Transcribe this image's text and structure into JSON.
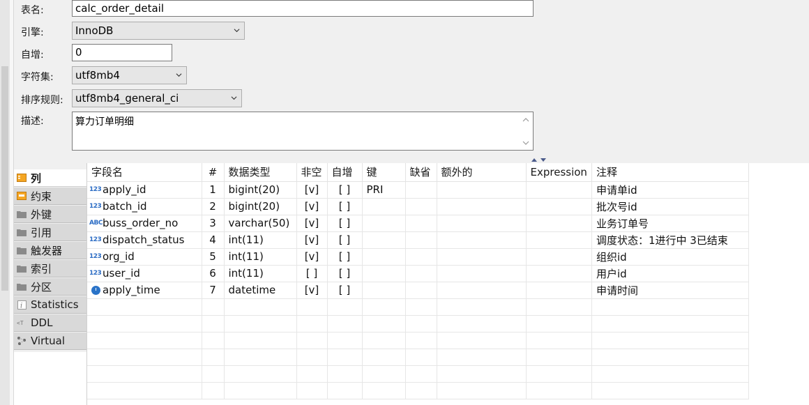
{
  "form": {
    "table_name_label": "表名:",
    "table_name_value": "calc_order_detail",
    "engine_label": "引擎:",
    "engine_value": "InnoDB",
    "auto_inc_label": "自增:",
    "auto_inc_value": "0",
    "charset_label": "字符集:",
    "charset_value": "utf8mb4",
    "collation_label": "排序规则:",
    "collation_value": "utf8mb4_general_ci",
    "description_label": "描述:",
    "description_value": "算力订单明细"
  },
  "tabs": [
    {
      "label": "列",
      "icon": "columns-icon",
      "active": true
    },
    {
      "label": "约束",
      "icon": "constraint-icon",
      "active": false
    },
    {
      "label": "外键",
      "icon": "folder-icon",
      "active": false
    },
    {
      "label": "引用",
      "icon": "folder-icon",
      "active": false
    },
    {
      "label": "触发器",
      "icon": "folder-icon",
      "active": false
    },
    {
      "label": "索引",
      "icon": "folder-icon",
      "active": false
    },
    {
      "label": "分区",
      "icon": "folder-icon",
      "active": false
    },
    {
      "label": "Statistics",
      "icon": "info-icon",
      "active": false
    },
    {
      "label": "DDL",
      "icon": "ddl-icon",
      "active": false
    },
    {
      "label": "Virtual",
      "icon": "virtual-icon",
      "active": false
    }
  ],
  "columns_table": {
    "headers": [
      "字段名",
      "#",
      "数据类型",
      "非空",
      "自增",
      "键",
      "缺省",
      "额外的",
      "Expression",
      "注释"
    ],
    "rows": [
      {
        "type_icon": "123",
        "name": "apply_id",
        "num": "1",
        "type": "bigint(20)",
        "not_null": "[v]",
        "auto_inc": "[ ]",
        "key": "PRI",
        "default": "",
        "extra": "",
        "expression": "",
        "comment": "申请单id"
      },
      {
        "type_icon": "123",
        "name": "batch_id",
        "num": "2",
        "type": "bigint(20)",
        "not_null": "[v]",
        "auto_inc": "[ ]",
        "key": "",
        "default": "",
        "extra": "",
        "expression": "",
        "comment": "批次号id"
      },
      {
        "type_icon": "ABC",
        "name": "buss_order_no",
        "num": "3",
        "type": "varchar(50)",
        "not_null": "[v]",
        "auto_inc": "[ ]",
        "key": "",
        "default": "",
        "extra": "",
        "expression": "",
        "comment": "业务订单号"
      },
      {
        "type_icon": "123",
        "name": "dispatch_status",
        "num": "4",
        "type": "int(11)",
        "not_null": "[v]",
        "auto_inc": "[ ]",
        "key": "",
        "default": "",
        "extra": "",
        "expression": "",
        "comment": "调度状态：1进行中 3已结束"
      },
      {
        "type_icon": "123",
        "name": "org_id",
        "num": "5",
        "type": "int(11)",
        "not_null": "[v]",
        "auto_inc": "[ ]",
        "key": "",
        "default": "",
        "extra": "",
        "expression": "",
        "comment": "组织id"
      },
      {
        "type_icon": "123",
        "name": "user_id",
        "num": "6",
        "type": "int(11)",
        "not_null": "[ ]",
        "auto_inc": "[ ]",
        "key": "",
        "default": "",
        "extra": "",
        "expression": "",
        "comment": "用户id"
      },
      {
        "type_icon": "clock",
        "name": "apply_time",
        "num": "7",
        "type": "datetime",
        "not_null": "[v]",
        "auto_inc": "[ ]",
        "key": "",
        "default": "",
        "extra": "",
        "expression": "",
        "comment": "申请时间"
      }
    ]
  }
}
